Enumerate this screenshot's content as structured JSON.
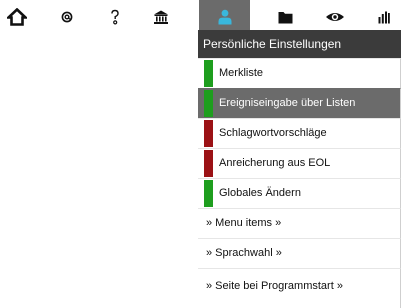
{
  "toolbar": {
    "buttons": [
      {
        "id": "home",
        "icon": "home-icon"
      },
      {
        "id": "at",
        "icon": "at-icon"
      },
      {
        "id": "help",
        "icon": "question-icon"
      },
      {
        "id": "museum",
        "icon": "museum-icon"
      },
      {
        "id": "user",
        "icon": "user-icon"
      },
      {
        "id": "folder",
        "icon": "folder-icon"
      },
      {
        "id": "eye",
        "icon": "eye-icon"
      },
      {
        "id": "stats",
        "icon": "bar-chart-icon"
      }
    ]
  },
  "menu": {
    "title": "Persönliche Einstellungen",
    "items": [
      {
        "label": "Merkliste",
        "status": "green"
      },
      {
        "label": "Ereigniseingabe über Listen",
        "status": "green"
      },
      {
        "label": "Schlagwortvorschläge",
        "status": "red"
      },
      {
        "label": "Anreicherung aus EOL",
        "status": "red"
      },
      {
        "label": "Globales Ändern",
        "status": "green"
      },
      {
        "label": "» Menu items »"
      },
      {
        "label": "» Sprachwahl »"
      },
      {
        "label": "» Seite bei Programmstart »"
      }
    ]
  },
  "colors": {
    "active_button": "#6b6b6b",
    "menu_header": "#3b3b3b",
    "highlight": "#6b6b6b",
    "status_green": "#1e9e1e",
    "status_red": "#9b1115",
    "user_icon": "#39b7dc"
  }
}
